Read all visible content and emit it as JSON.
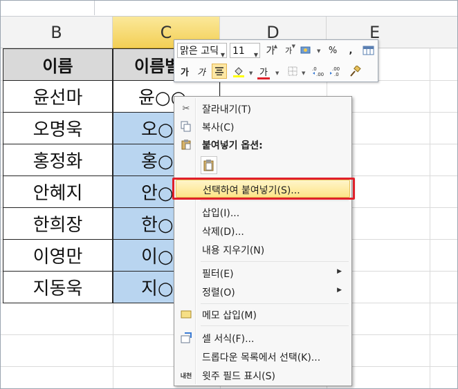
{
  "columns": [
    "B",
    "C",
    "D",
    "E"
  ],
  "header_row": {
    "b": "이름",
    "c": "이름별"
  },
  "rows": [
    {
      "name": "윤선마",
      "masked": "윤○○"
    },
    {
      "name": "오명욱",
      "masked": "오○"
    },
    {
      "name": "홍정화",
      "masked": "홍○"
    },
    {
      "name": "안혜지",
      "masked": "안○"
    },
    {
      "name": "한희장",
      "masked": "한○"
    },
    {
      "name": "이영만",
      "masked": "이○"
    },
    {
      "name": "지동욱",
      "masked": "지○"
    }
  ],
  "mini_toolbar": {
    "font_name": "맑은 고딕",
    "font_size": "11",
    "grow_font": "가",
    "shrink_font": "가",
    "percent": "%",
    "comma": ",",
    "bold": "가",
    "italic": "가",
    "font_color": "가",
    "font_color_hex": "#e0202a",
    "fill_color_hex": "#ffff00"
  },
  "context_menu": {
    "cut": "잘라내기(T)",
    "copy": "복사(C)",
    "paste_options": "붙여넣기 옵션:",
    "paste_special": "선택하여 붙여넣기(S)...",
    "insert": "삽입(I)...",
    "delete": "삭제(D)...",
    "clear_contents": "내용 지우기(N)",
    "filter": "필터(E)",
    "sort": "정렬(O)",
    "insert_comment": "메모 삽입(M)",
    "format_cells": "셀 서식(F)...",
    "pick_from_list": "드롭다운 목록에서 선택(K)...",
    "phonetic": "윗주 필드 표시(S)",
    "phonetic_icon_text": "내천"
  },
  "colors": {
    "selection_fill": "#b9d5f0",
    "selected_header": "#f3cf55",
    "highlight_border": "#e0202a"
  }
}
